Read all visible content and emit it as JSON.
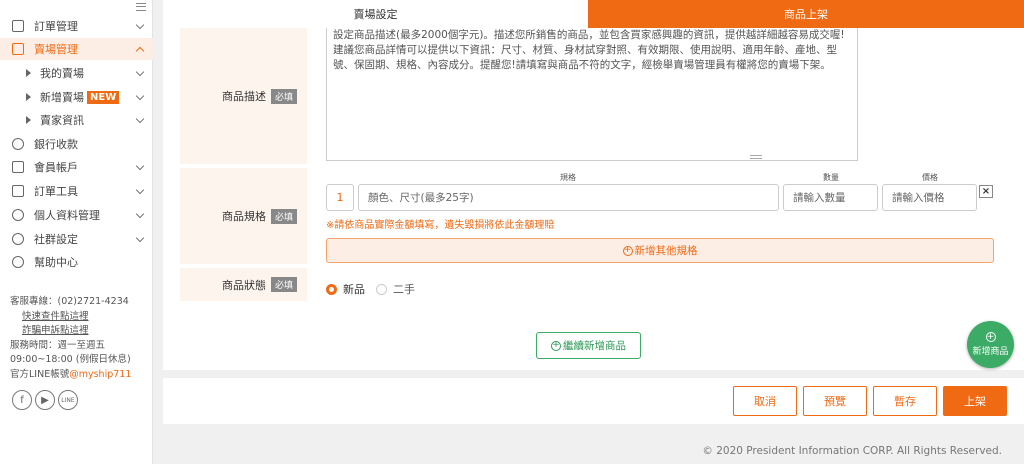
{
  "sidebar": {
    "items": [
      {
        "label": "訂單管理",
        "icon": "clipboard-icon"
      },
      {
        "label": "賣場管理",
        "icon": "store-icon"
      },
      {
        "label": "我的賣場"
      },
      {
        "label": "新增賣場",
        "badge": "NEW"
      },
      {
        "label": "賣家資訊"
      },
      {
        "label": "銀行收款",
        "icon": "dollar-icon"
      },
      {
        "label": "會員帳戶",
        "icon": "wallet-icon"
      },
      {
        "label": "訂單工具",
        "icon": "briefcase-icon"
      },
      {
        "label": "個人資料管理",
        "icon": "gear-icon"
      },
      {
        "label": "社群設定",
        "icon": "users-icon"
      },
      {
        "label": "幫助中心",
        "icon": "help-icon"
      }
    ],
    "contact": {
      "phone": "客服專線：(02)2721-4234",
      "link1": "快速查件點這裡",
      "link2": "詐騙申訴點這裡",
      "hours_days": "服務時間：週一至週五",
      "hours_time": "09:00~18:00 (例假日休息)",
      "line_label": "官方LINE帳號",
      "line_id": "@myship711"
    },
    "social": {
      "fb": "f",
      "yt": "▶",
      "line": "LINE"
    }
  },
  "tabs": {
    "tab1": "賣場設定",
    "tab2": "商品上架"
  },
  "form": {
    "desc_label": "商品描述",
    "required": "必填",
    "desc_text": "設定商品描述(最多2000個字元)。描述您所銷售的商品，並包含買家感興趣的資訊，提供越詳細越容易成交喔!建議您商品詳情可以提供以下資訊：尺寸、材質、身材試穿對照、有效期限、使用說明、適用年齡、產地、型號、保固期、規格、內容成分。提醒您!請填寫與商品不符的文字，經檢舉賣場管理員有權將您的賣場下架。",
    "spec_label": "商品規格",
    "col_spec": "規格",
    "col_qty": "數量",
    "col_price": "價格",
    "row_num": "1",
    "spec_placeholder": "顏色、尺寸(最多25字)",
    "qty_placeholder": "請輸入數量",
    "price_placeholder": "請輸入價格",
    "remove": "×",
    "warning": "※請依商品實際金額填寫，遺失毀損將依此金額理賠",
    "add_spec": "新增其他規格",
    "status_label": "商品狀態",
    "status_new": "新品",
    "status_used": "二手",
    "continue_add": "繼續新增商品"
  },
  "fab": {
    "label": "新增商品"
  },
  "actions": {
    "cancel": "取消",
    "preview": "預覽",
    "draft": "暫存",
    "publish": "上架"
  },
  "footer": "© 2020 President Information CORP. All Rights Reserved.",
  "colors": {
    "accent": "#f06a14",
    "green": "#3bab65"
  }
}
